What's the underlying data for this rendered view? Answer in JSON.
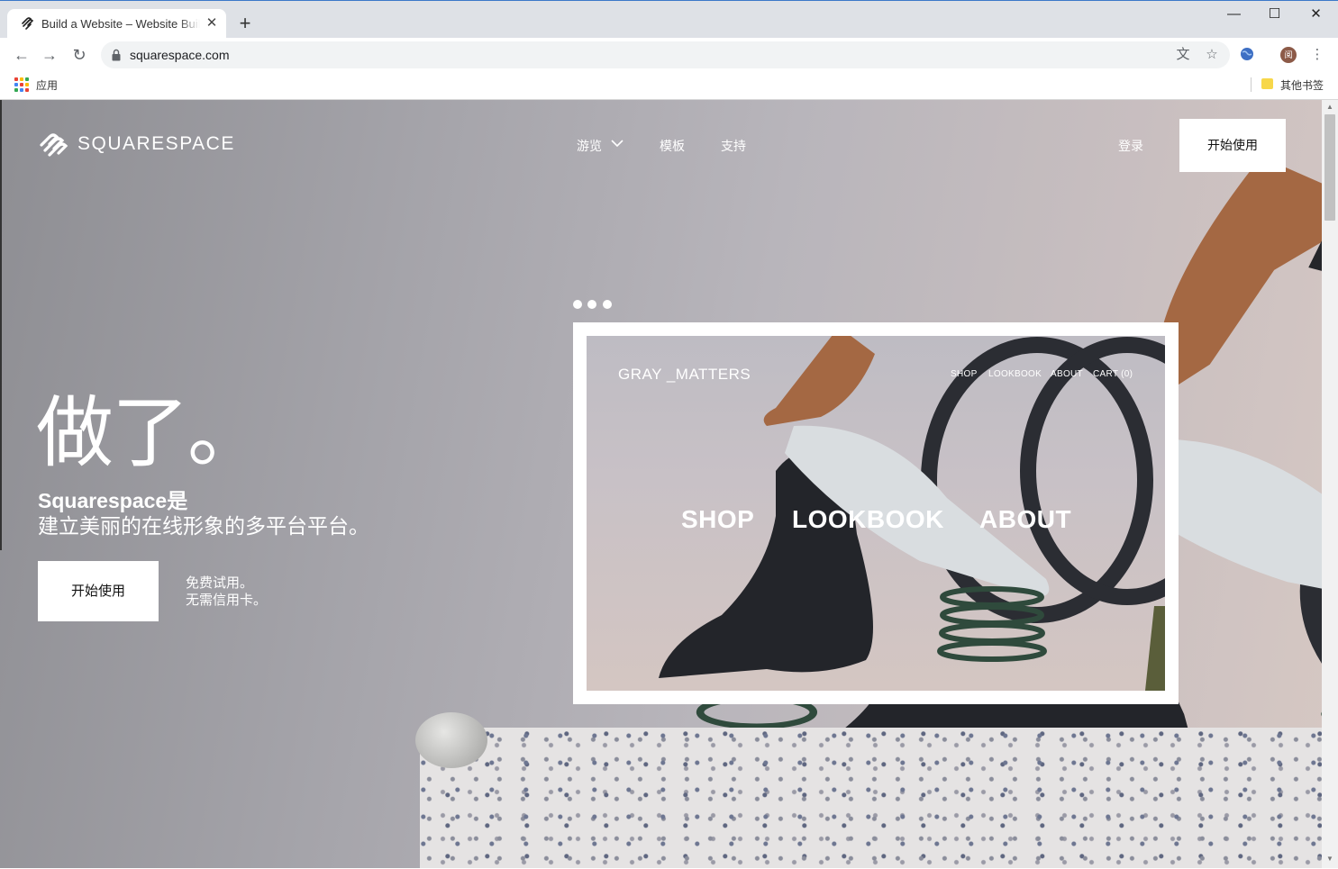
{
  "browser": {
    "tab_title": "Build a Website – Website Builder",
    "tab_close": "✕",
    "new_tab": "+",
    "url": "squarespace.com",
    "window_controls": {
      "minimize": "—",
      "maximize": "☐",
      "close": "✕"
    },
    "bookmarks": {
      "apps_label": "应用",
      "other_bookmarks": "其他书签"
    },
    "avatar_initial": "阅"
  },
  "site": {
    "logo_text": "SQUARESPACE",
    "nav": {
      "browse": "游览",
      "templates": "模板",
      "support": "支持"
    },
    "login": "登录",
    "cta_top": "开始使用",
    "hero": {
      "title": "做了。",
      "subtitle_line1": "Squarespace是",
      "subtitle_line2": "建立美丽的在线形象的多平台平台。",
      "cta": "开始使用",
      "trial_line1": "免费试用。",
      "trial_line2": "无需信用卡。"
    },
    "mockup": {
      "logo": "GRAY _MATTERS",
      "nav": [
        "SHOP",
        "LOOKBOOK",
        "ABOUT",
        "CART (0)"
      ],
      "big_links": [
        "SHOP",
        "LOOKBOOK",
        "ABOUT"
      ]
    }
  },
  "colors": {
    "accent": "#3b78c9",
    "cta_bg": "#ffffff",
    "hero_text": "#ffffff"
  }
}
